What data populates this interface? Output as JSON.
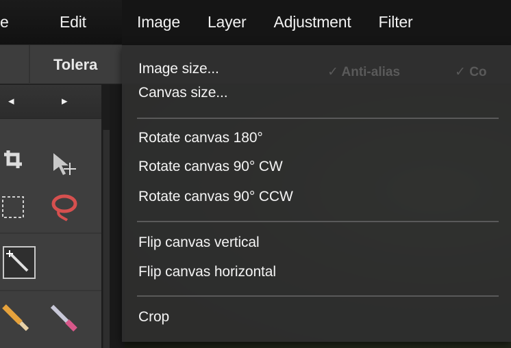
{
  "menubar": {
    "items": [
      {
        "label": "e"
      },
      {
        "label": "Edit"
      },
      {
        "label": "Image"
      },
      {
        "label": "Layer"
      },
      {
        "label": "Adjustment"
      },
      {
        "label": "Filter"
      }
    ]
  },
  "options_bar": {
    "tolerance_label": "Tolera",
    "anti_alias_label": "✓ Anti-alias",
    "contiguous_label": "✓ Co"
  },
  "tool_panel": {
    "prev_arrow": "◂",
    "next_arrow": "▸",
    "tools": [
      "crop-tool",
      "move-tool",
      "marquee-tool",
      "lasso-tool",
      "magic-wand-tool",
      "pencil-tool",
      "brush-tool"
    ]
  },
  "image_menu": {
    "groups": [
      [
        "Image size...",
        "Canvas size..."
      ],
      [
        "Rotate canvas 180°",
        "Rotate canvas 90° CW",
        "Rotate canvas 90° CCW"
      ],
      [
        "Flip canvas vertical",
        "Flip canvas horizontal"
      ],
      [
        "Crop"
      ]
    ]
  },
  "colors": {
    "menubar_bg": "#151515",
    "dropdown_bg": "#2e2e2e",
    "panel_bg": "#3e3e3e",
    "lasso_red": "#d6504f",
    "text": "#f4f4f4"
  }
}
